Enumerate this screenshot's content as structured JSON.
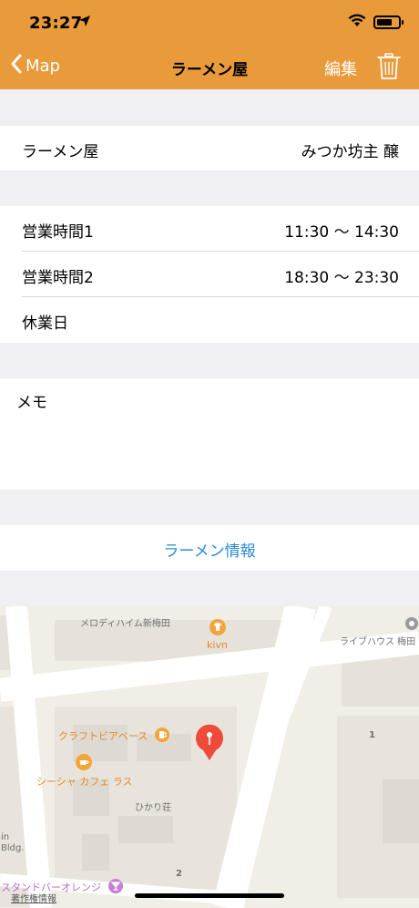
{
  "status": {
    "time": "23:27"
  },
  "nav": {
    "back_label": "Map",
    "title": "ラーメン屋",
    "edit_label": "編集"
  },
  "shop": {
    "label": "ラーメン屋",
    "name": "みつか坊主 醸"
  },
  "hours": [
    {
      "label": "営業時間1",
      "value": "11:30 〜 14:30"
    },
    {
      "label": "営業時間2",
      "value": "18:30 〜 23:30"
    },
    {
      "label": "休業日",
      "value": ""
    }
  ],
  "memo": {
    "label": "メモ"
  },
  "ramen_info_link": "ラーメン情報",
  "map": {
    "labels": {
      "melody": "メロディハイム新梅田",
      "kivn": "kivn",
      "livehouse": "ライブハウス 梅田",
      "craft": "クラフトビアベース",
      "shisha": "シーシャ カフェ ラス",
      "hikari": "ひかり荘",
      "num1": "1",
      "num2": "2",
      "in": "in",
      "bldg": "Bldg.",
      "stand": "スタンドバーオレンジ",
      "legal": "著作権情報"
    }
  }
}
